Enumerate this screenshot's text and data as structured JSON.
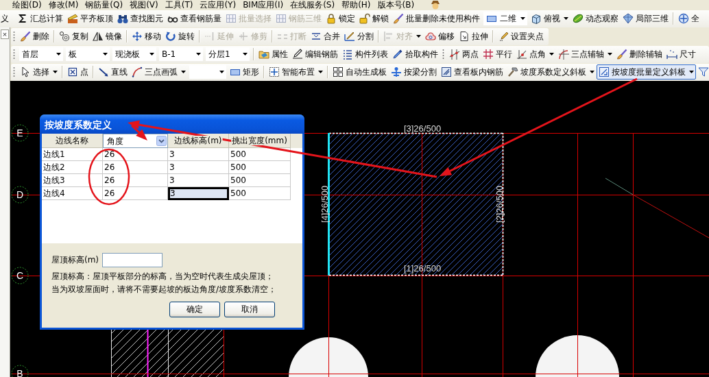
{
  "menu": [
    {
      "label": "绘图(D)"
    },
    {
      "label": "修改(M)"
    },
    {
      "label": "钢筋量(Q)"
    },
    {
      "label": "视图(V)"
    },
    {
      "label": "工具(T)"
    },
    {
      "label": "云应用(Y)"
    },
    {
      "label": "BIM应用(I)"
    },
    {
      "label": "在线服务(S)"
    },
    {
      "label": "帮助(H)"
    },
    {
      "label": "版本号(B)"
    }
  ],
  "toolbars": [
    {
      "items": [
        {
          "kind": "button",
          "label": "义",
          "disabled": false
        },
        {
          "kind": "button",
          "label": "汇总计算",
          "disabled": false
        },
        {
          "kind": "button",
          "label": "平齐板顶",
          "disabled": false
        },
        {
          "kind": "button",
          "label": "查找图元",
          "disabled": false
        },
        {
          "kind": "button",
          "label": "查看钢筋量",
          "disabled": false
        },
        {
          "kind": "button",
          "label": "批量选择",
          "disabled": true
        },
        {
          "kind": "button",
          "label": "钢筋三维",
          "disabled": true
        },
        {
          "kind": "button",
          "label": "锁定",
          "disabled": false
        },
        {
          "kind": "button",
          "label": "解锁",
          "disabled": false
        },
        {
          "kind": "button",
          "label": "批量删除未使用构件",
          "disabled": false
        },
        {
          "kind": "combo",
          "value": "二维"
        },
        {
          "kind": "menu-button",
          "label": "俯视",
          "disabled": false
        },
        {
          "kind": "button",
          "label": "动态观察",
          "disabled": false
        },
        {
          "kind": "button",
          "label": "局部三维",
          "disabled": false
        },
        {
          "kind": "separator"
        },
        {
          "kind": "button",
          "label": "全",
          "disabled": false
        }
      ]
    },
    {
      "items": [
        {
          "kind": "grip"
        },
        {
          "kind": "button",
          "label": "删除",
          "disabled": false
        },
        {
          "kind": "separator"
        },
        {
          "kind": "button",
          "label": "复制",
          "disabled": false
        },
        {
          "kind": "button",
          "label": "镜像",
          "disabled": false
        },
        {
          "kind": "separator"
        },
        {
          "kind": "button",
          "label": "移动",
          "disabled": false
        },
        {
          "kind": "button",
          "label": "旋转",
          "disabled": false
        },
        {
          "kind": "separator"
        },
        {
          "kind": "button",
          "label": "延伸",
          "disabled": true
        },
        {
          "kind": "button",
          "label": "修剪",
          "disabled": true
        },
        {
          "kind": "separator"
        },
        {
          "kind": "button",
          "label": "打断",
          "disabled": true
        },
        {
          "kind": "button",
          "label": "合并",
          "disabled": false
        },
        {
          "kind": "button",
          "label": "分割",
          "disabled": false
        },
        {
          "kind": "separator"
        },
        {
          "kind": "menu-button",
          "label": "对齐",
          "disabled": true
        },
        {
          "kind": "button",
          "label": "偏移",
          "disabled": false
        },
        {
          "kind": "button",
          "label": "拉伸",
          "disabled": false
        },
        {
          "kind": "separator"
        },
        {
          "kind": "button",
          "label": "设置夹点",
          "disabled": false
        }
      ]
    },
    {
      "items": [
        {
          "kind": "grip"
        },
        {
          "kind": "combo",
          "value": "首层"
        },
        {
          "kind": "combo",
          "value": "板"
        },
        {
          "kind": "combo",
          "value": "现浇板"
        },
        {
          "kind": "combo",
          "value": "B-1"
        },
        {
          "kind": "combo",
          "value": "分层1"
        },
        {
          "kind": "separator"
        },
        {
          "kind": "button",
          "label": "属性"
        },
        {
          "kind": "button",
          "label": "编辑钢筋"
        },
        {
          "kind": "button",
          "label": "构件列表"
        },
        {
          "kind": "button",
          "label": "拾取构件"
        },
        {
          "kind": "grip"
        },
        {
          "kind": "button",
          "label": "两点"
        },
        {
          "kind": "button",
          "label": "平行"
        },
        {
          "kind": "menu-button",
          "label": "点角"
        },
        {
          "kind": "menu-button",
          "label": "三点辅轴"
        },
        {
          "kind": "button",
          "label": "删除辅轴"
        },
        {
          "kind": "button",
          "label": "尺寸"
        }
      ]
    },
    {
      "items": [
        {
          "kind": "grip"
        },
        {
          "kind": "menu-button",
          "label": "选择",
          "pressed": false
        },
        {
          "kind": "separator"
        },
        {
          "kind": "button",
          "label": "点",
          "pressed": false
        },
        {
          "kind": "separator"
        },
        {
          "kind": "button",
          "label": "直线",
          "pressed": false
        },
        {
          "kind": "menu-button",
          "label": "三点画弧",
          "pressed": false
        },
        {
          "kind": "combo"
        },
        {
          "kind": "button",
          "label": "矩形",
          "pressed": false
        },
        {
          "kind": "separator"
        },
        {
          "kind": "menu-button",
          "label": "智能布置",
          "pressed": false
        },
        {
          "kind": "separator"
        },
        {
          "kind": "button",
          "label": "自动生成板",
          "pressed": false
        },
        {
          "kind": "button",
          "label": "按梁分割",
          "pressed": false
        },
        {
          "kind": "button",
          "label": "查看板内钢筋",
          "pressed": false
        },
        {
          "kind": "menu-button",
          "label": "坡度系数定义斜板",
          "pressed": false
        },
        {
          "kind": "menu-button",
          "label": "按坡度批量定义斜板",
          "pressed": true
        },
        {
          "kind": "button",
          "pressed": false
        }
      ]
    }
  ],
  "side_panel": {
    "close": "×"
  },
  "canvas": {
    "axes": [
      {
        "label": "E"
      },
      {
        "label": "D"
      },
      {
        "label": "C"
      },
      {
        "label": "B"
      }
    ],
    "slab_edges": [
      {
        "label": "[3]26/500",
        "selected": false
      },
      {
        "label": "[4]26/500",
        "selected": true
      },
      {
        "label": "[2]26/500",
        "selected": false
      },
      {
        "label": "[1]26/500",
        "selected": false
      }
    ]
  },
  "dialog": {
    "title": "按坡度系数定义",
    "columns": [
      {
        "label": "边线名称",
        "kind": "text"
      },
      {
        "label": "角度",
        "kind": "dropdown"
      },
      {
        "label": "边线标高(m)",
        "kind": "text"
      },
      {
        "label": "挑出宽度(mm)",
        "kind": "text"
      }
    ],
    "rows": [
      {
        "cells": [
          {
            "text": "边线1",
            "selected": false
          },
          {
            "text": "26",
            "selected": false
          },
          {
            "text": "3",
            "selected": false
          },
          {
            "text": "500",
            "selected": false
          }
        ]
      },
      {
        "cells": [
          {
            "text": "边线2",
            "selected": false
          },
          {
            "text": "26",
            "selected": false
          },
          {
            "text": "3",
            "selected": false
          },
          {
            "text": "500",
            "selected": false
          }
        ]
      },
      {
        "cells": [
          {
            "text": "边线3",
            "selected": false
          },
          {
            "text": "26",
            "selected": false
          },
          {
            "text": "3",
            "selected": false
          },
          {
            "text": "500",
            "selected": false
          }
        ]
      },
      {
        "cells": [
          {
            "text": "边线4",
            "selected": false
          },
          {
            "text": "26",
            "selected": false
          },
          {
            "text": "3",
            "selected": true
          },
          {
            "text": "500",
            "selected": false
          }
        ]
      }
    ],
    "roof_height": {
      "label": "屋顶标高(m)"
    },
    "notes": [
      "屋顶标高：屋顶平板部分的标高，当为空时代表生成尖屋顶；",
      "当为双坡屋面时，请将不需要起坡的板边角度/坡度系数清空；"
    ],
    "buttons": [
      {
        "label": "确定"
      },
      {
        "label": "取消"
      }
    ]
  }
}
